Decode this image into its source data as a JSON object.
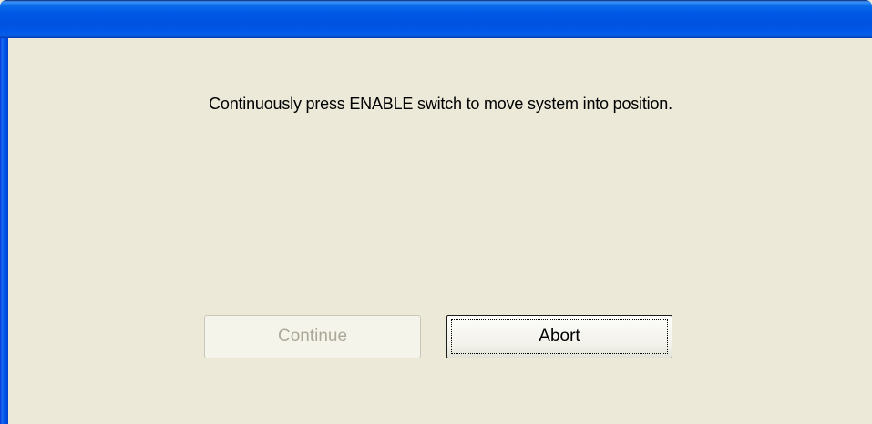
{
  "dialog": {
    "message": "Continuously press ENABLE switch to move system into position.",
    "buttons": {
      "continue_label": "Continue",
      "abort_label": "Abort"
    }
  },
  "colors": {
    "titlebar": "#0058e6",
    "client_background": "#ece9d8",
    "disabled_text": "#aca899"
  }
}
